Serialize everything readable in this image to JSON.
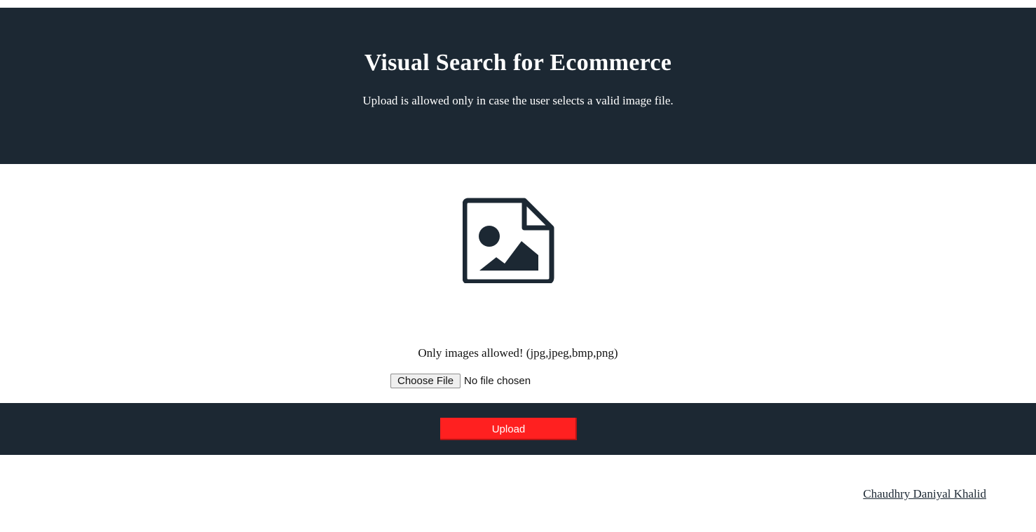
{
  "header": {
    "title": "Visual Search for Ecommerce",
    "subtitle": "Upload is allowed only in case the user selects a valid image file."
  },
  "placeholder_icon": "image-file-icon",
  "upload_form": {
    "allowed_text": "Only images allowed! (jpg,jpeg,bmp,png)",
    "choose_button_label": "Choose File",
    "file_status": "No file chosen",
    "upload_button_label": "Upload"
  },
  "footer": {
    "author_link": "Chaudhry Daniyal Khalid"
  },
  "colors": {
    "header_background": "#1c2833",
    "upload_button": "#ff2020",
    "text_on_dark": "#ffffff"
  }
}
